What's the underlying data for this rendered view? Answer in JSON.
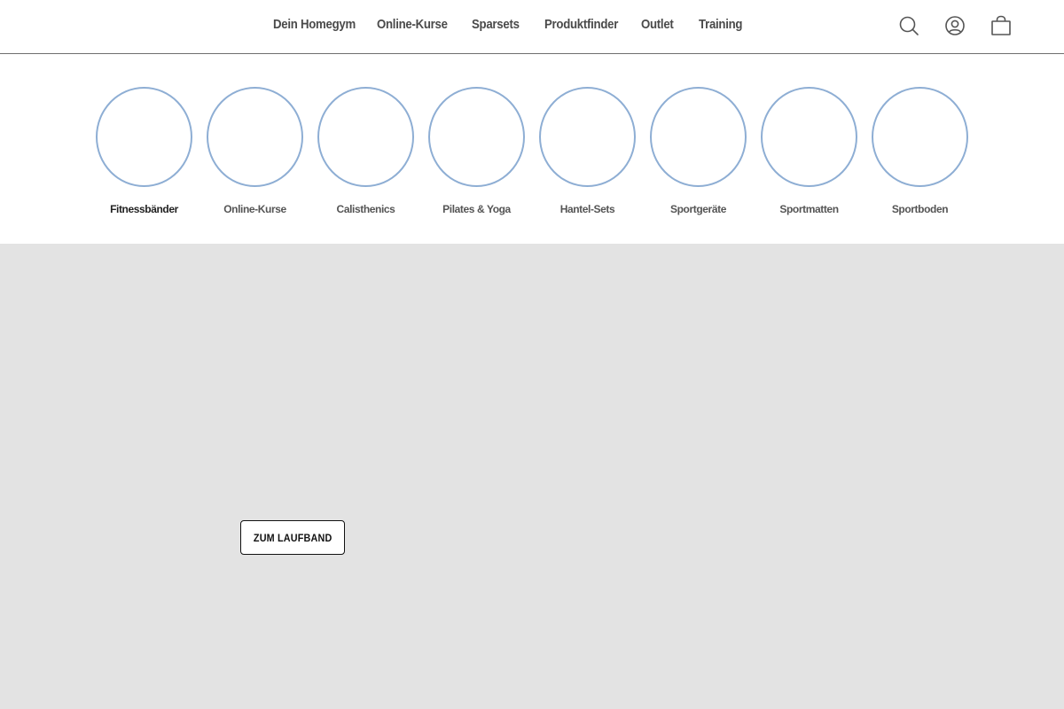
{
  "nav": {
    "items": [
      {
        "label": "Dein Homegym"
      },
      {
        "label": "Online-Kurse"
      },
      {
        "label": "Sparsets"
      },
      {
        "label": "Produktfinder"
      },
      {
        "label": "Outlet"
      },
      {
        "label": "Training"
      }
    ]
  },
  "header_icons": {
    "search": "search-icon",
    "account": "account-icon",
    "cart": "shopping-bag-icon"
  },
  "categories": {
    "items": [
      {
        "label": "Fitnessbänder",
        "active": true
      },
      {
        "label": "Online-Kurse",
        "active": false
      },
      {
        "label": "Calisthenics",
        "active": false
      },
      {
        "label": "Pilates & Yoga",
        "active": false
      },
      {
        "label": "Hantel-Sets",
        "active": false
      },
      {
        "label": "Sportgeräte",
        "active": false
      },
      {
        "label": "Sportmatten",
        "active": false
      },
      {
        "label": "Sportboden",
        "active": false
      }
    ],
    "circle_color": "#8eaed4"
  },
  "hero": {
    "button_label": "ZUM LAUFBAND",
    "background_color": "#e3e3e3"
  }
}
